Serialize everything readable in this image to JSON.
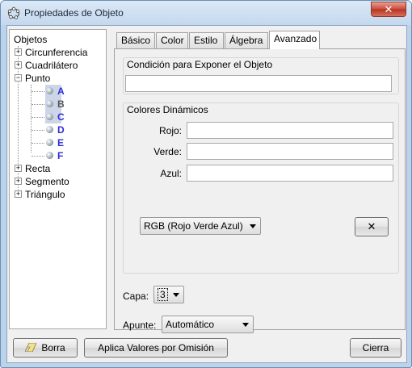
{
  "window": {
    "title": "Propiedades de Objeto",
    "close_glyph": "✕"
  },
  "tree": {
    "root": "Objetos",
    "items": [
      {
        "label": "Circunferencia",
        "toggle": "+"
      },
      {
        "label": "Cuadrilátero",
        "toggle": "+"
      },
      {
        "label": "Punto",
        "toggle": "−"
      },
      {
        "label": "Recta",
        "toggle": "+"
      },
      {
        "label": "Segmento",
        "toggle": "+"
      },
      {
        "label": "Triángulo",
        "toggle": "+"
      }
    ],
    "points": [
      "A",
      "B",
      "C",
      "D",
      "E",
      "F"
    ]
  },
  "tabs": [
    {
      "label": "Básico"
    },
    {
      "label": "Color"
    },
    {
      "label": "Estilo"
    },
    {
      "label": "Álgebra"
    },
    {
      "label": "Avanzado",
      "active": true
    }
  ],
  "advanced": {
    "condition_title": "Condición para Exponer el Objeto",
    "condition_value": "",
    "dynamic_colors_title": "Colores Dinámicos",
    "red_label": "Rojo:",
    "green_label": "Verde:",
    "blue_label": "Azul:",
    "red_value": "",
    "green_value": "",
    "blue_value": "",
    "color_space": "RGB (Rojo Verde Azul)",
    "clear_button": "✕",
    "layer_label": "Capa:",
    "layer_value": "3",
    "snap_label": "Apunte:",
    "snap_value": "Automático"
  },
  "footer": {
    "delete_button": "Borra",
    "defaults_button": "Aplica Valores por Omisión",
    "close_button": "Cierra"
  },
  "icons": {
    "app": "geogebra-app-icon",
    "eraser": "eraser-icon"
  }
}
